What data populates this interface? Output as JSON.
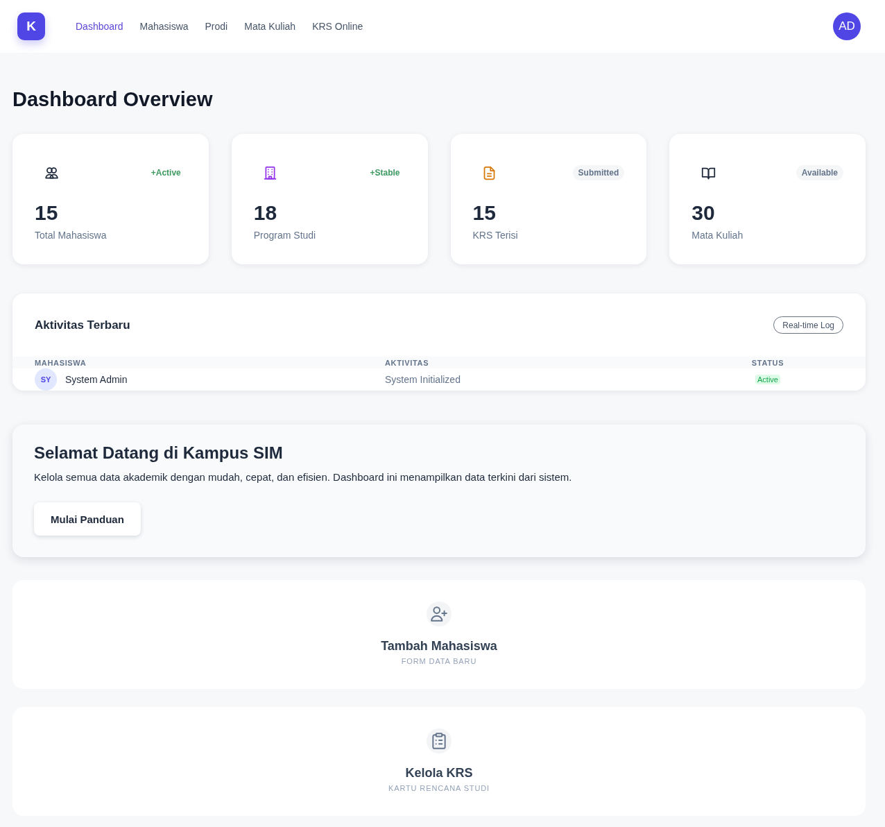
{
  "header": {
    "logo": "K",
    "nav": [
      {
        "label": "Dashboard",
        "selected": true
      },
      {
        "label": "Mahasiswa",
        "selected": false
      },
      {
        "label": "Prodi",
        "selected": false
      },
      {
        "label": "Mata Kuliah",
        "selected": false
      },
      {
        "label": "KRS Online",
        "selected": false
      }
    ],
    "avatar": "AD"
  },
  "page_title": "Dashboard Overview",
  "stats": [
    {
      "color": "#1e293b",
      "badge": {
        "text": "+Active",
        "kind": "trend"
      },
      "value": "15",
      "label": "Total Mahasiswa"
    },
    {
      "color": "#9333ea",
      "badge": {
        "text": "+Stable",
        "kind": "trend"
      },
      "value": "18",
      "label": "Program Studi"
    },
    {
      "color": "#d97706",
      "badge": {
        "text": "Submitted",
        "kind": "tag"
      },
      "value": "15",
      "label": "KRS Terisi"
    },
    {
      "color": "#1e293b",
      "badge": {
        "text": "Available",
        "kind": "tag"
      },
      "value": "30",
      "label": "Mata Kuliah"
    }
  ],
  "activity": {
    "title": "Aktivitas Terbaru",
    "button": "Real-time Log",
    "columns": [
      "MAHASISWA",
      "AKTIVITAS",
      "STATUS"
    ],
    "rows": [
      {
        "initials": "SY",
        "name": "System Admin",
        "activity": "System Initialized",
        "status": "Active"
      }
    ]
  },
  "welcome": {
    "title": "Selamat Datang di Kampus SIM",
    "text": "Kelola semua data akademik dengan mudah, cepat, dan efisien. Dashboard ini menampilkan data terkini dari sistem.",
    "button": "Mulai Panduan"
  },
  "actions": [
    {
      "title": "Tambah Mahasiswa",
      "subtitle": "FORM DATA BARU"
    },
    {
      "title": "Kelola KRS",
      "subtitle": "KARTU RENCANA STUDI"
    }
  ]
}
